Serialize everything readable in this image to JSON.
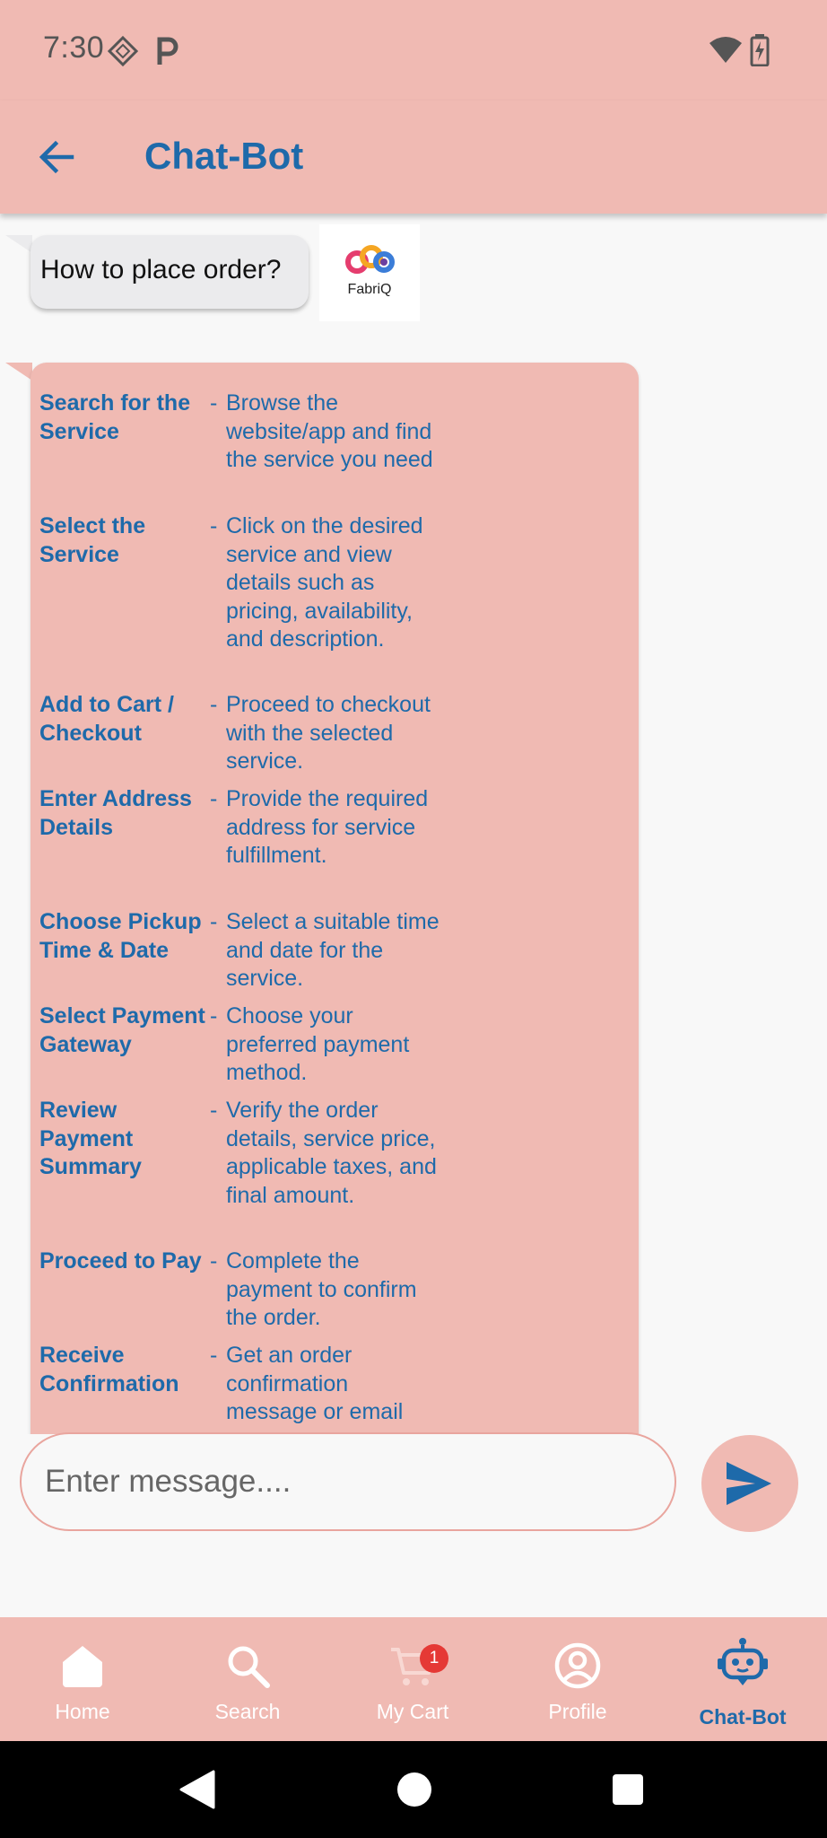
{
  "status_bar": {
    "time": "7:30",
    "icons": [
      "location-diamond-icon",
      "parking-p-icon",
      "wifi-icon",
      "battery-charging-icon"
    ]
  },
  "app_bar": {
    "back_icon": "arrow-left-icon",
    "title": "Chat-Bot"
  },
  "chat": {
    "user_message": "How to place order?",
    "bot_avatar_label": "FabriQ",
    "steps": [
      {
        "label": "Search for the Service",
        "dash": "-",
        "desc": "Browse the website/app and find the service you need"
      },
      {
        "label": "Select the Service",
        "dash": "-",
        "desc": "Click on the desired service and view details such as pricing, availability, and description."
      },
      {
        "label": "Add to Cart / Checkout",
        "dash": "-",
        "desc": "Proceed to checkout with the selected service."
      },
      {
        "label": "Enter Address Details",
        "dash": "-",
        "desc": "Provide the required address for service fulfillment."
      },
      {
        "label": "Choose Pickup Time & Date",
        "dash": "-",
        "desc": "Select a suitable time and date for the service."
      },
      {
        "label": "Select Payment Gateway",
        "dash": "-",
        "desc": "Choose your preferred payment method."
      },
      {
        "label": "Review Payment Summary",
        "dash": "-",
        "desc": " Verify the order details, service price, applicable taxes, and final amount."
      },
      {
        "label": "Proceed to Pay",
        "dash": "-",
        "desc": "Complete the payment to confirm the order."
      },
      {
        "label": "Receive Confirmation",
        "dash": "-",
        "desc": "Get an order confirmation message or email"
      }
    ]
  },
  "composer": {
    "placeholder": "Enter message....",
    "value": "",
    "send_icon": "send-icon"
  },
  "bottom_nav": {
    "items": [
      {
        "label": "Home",
        "icon": "home-icon"
      },
      {
        "label": "Search",
        "icon": "search-icon"
      },
      {
        "label": "My Cart",
        "icon": "cart-icon",
        "badge": "1"
      },
      {
        "label": "Profile",
        "icon": "profile-icon"
      },
      {
        "label": "Chat-Bot",
        "icon": "robot-icon",
        "active": true
      }
    ]
  },
  "colors": {
    "primary_bg": "#F0BAB3",
    "accent": "#1E6AAA",
    "badge": "#E53935"
  }
}
